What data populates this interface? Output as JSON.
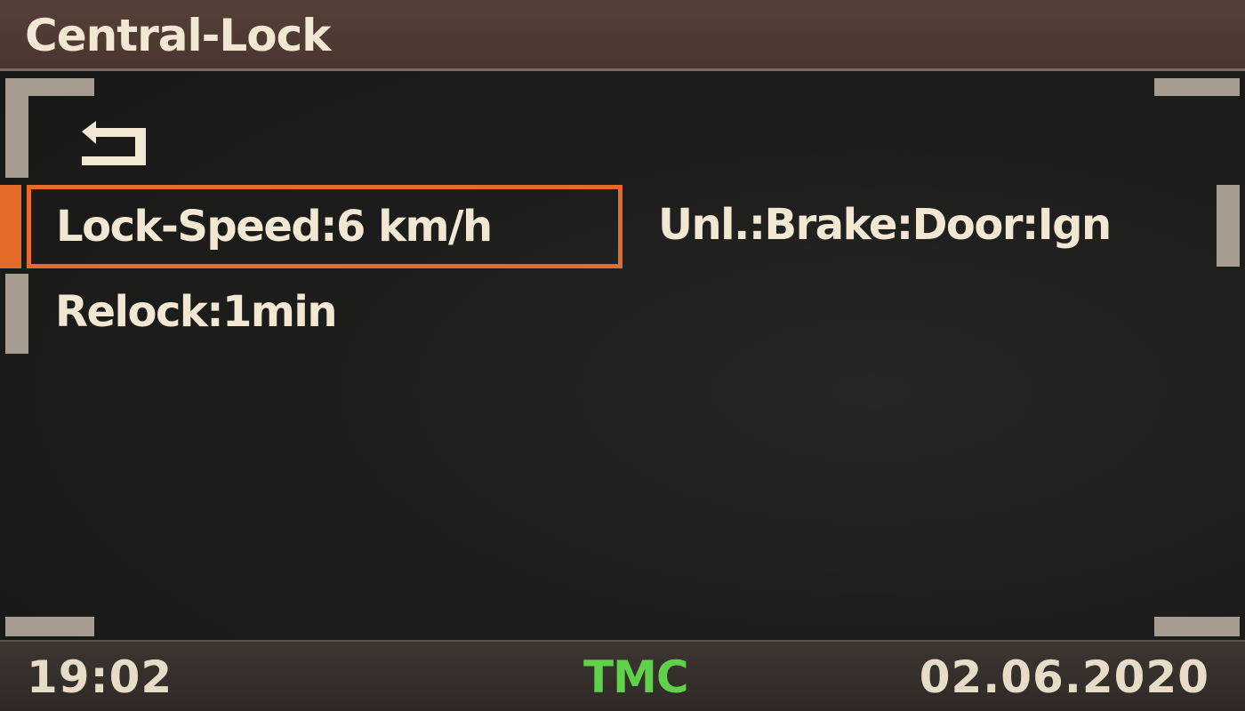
{
  "header": {
    "title": "Central-Lock"
  },
  "menu": {
    "back_icon": "return-arrow-icon",
    "items": [
      {
        "label": "Lock-Speed:6 km/h",
        "selected": true
      },
      {
        "label": "Unl.:Brake:Door:Ign",
        "selected": false
      },
      {
        "label": "Relock:1min",
        "selected": false
      }
    ]
  },
  "status": {
    "time": "19:02",
    "tmc": "TMC",
    "date": "02.06.2020"
  },
  "colors": {
    "accent": "#e46b2a",
    "tmc": "#5fd24a",
    "text": "#f1e7d2",
    "title_bar": "#4f3a33"
  }
}
